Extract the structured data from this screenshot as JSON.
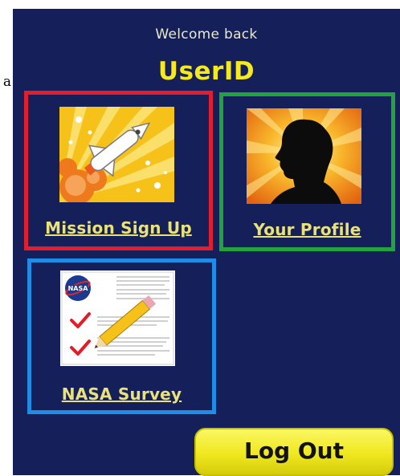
{
  "stray_text": "a",
  "header": {
    "welcome": "Welcome back",
    "user_id": "UserID"
  },
  "tiles": [
    {
      "label": "Mission Sign Up",
      "icon": "space-shuttle-launch-icon",
      "border_color": "#e21e2e"
    },
    {
      "label": "Your Profile",
      "icon": "profile-silhouette-icon",
      "border_color": "#23a33d"
    },
    {
      "label": "NASA Survey",
      "icon": "survey-checklist-icon",
      "border_color": "#1f8de6"
    }
  ],
  "logout": {
    "label": "Log Out"
  },
  "colors": {
    "panel_background": "#15205a",
    "user_id_text": "#f5ea1c",
    "link_text": "#e9e27a",
    "logout_button": "#efe81e"
  }
}
